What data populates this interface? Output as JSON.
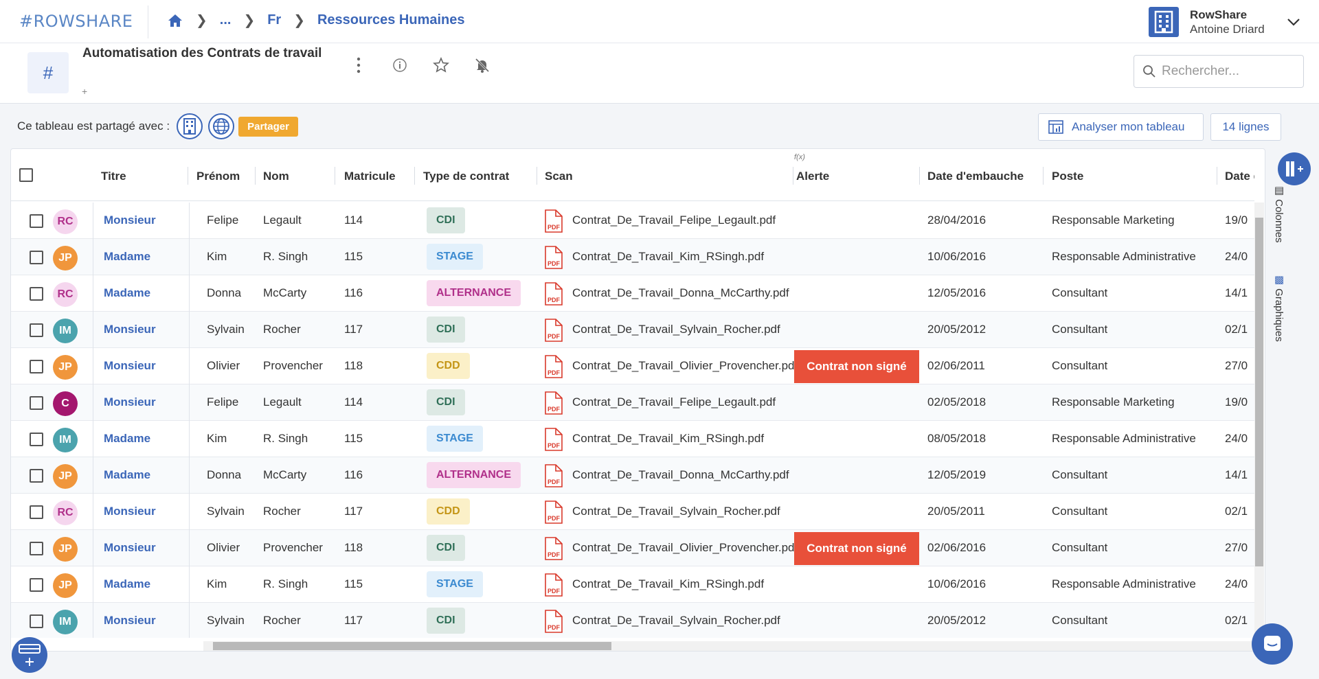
{
  "header": {
    "logo": "#ROWSHARE",
    "breadcrumb": [
      "...",
      "Fr",
      "Ressources Humaines"
    ],
    "account_org": "RowShare",
    "account_user": "Antoine Driard"
  },
  "sheet": {
    "title": "Automatisation des Contrats de travail",
    "add_label": "+",
    "search_placeholder": "Rechercher..."
  },
  "share": {
    "label": "Ce tableau est partagé avec :",
    "button": "Partager",
    "analyse": "Analyser mon tableau",
    "lines": "14 lignes"
  },
  "columns": [
    "Titre",
    "Prénom",
    "Nom",
    "Matricule",
    "Type de contrat",
    "Scan",
    "Alerte",
    "Date d'embauche",
    "Poste",
    "Date de"
  ],
  "fx_label": "f(x)",
  "side": {
    "colonnes": "Colonnes",
    "graphiques": "Graphiques"
  },
  "colors": {
    "accent": "#3b66b8",
    "alert": "#e8503a",
    "share_orange": "#f0a830",
    "tag_CDI": "#dde9e4",
    "tag_STAGE": "#e2f0fb",
    "tag_ALTERNANCE": "#f8d9ee",
    "tag_CDD": "#fbf0c8"
  },
  "rows": [
    {
      "avatar": "RC",
      "avatar_color": "pink",
      "titre": "Monsieur",
      "prenom": "Felipe",
      "nom": "Legault",
      "matricule": "114",
      "type": "CDI",
      "scan": "Contrat_De_Travail_Felipe_Legault.pdf",
      "alerte": "",
      "date": "28/04/2016",
      "poste": "Responsable Marketing",
      "date2": "19/0"
    },
    {
      "avatar": "JP",
      "avatar_color": "orange",
      "titre": "Madame",
      "prenom": "Kim",
      "nom": "R. Singh",
      "matricule": "115",
      "type": "STAGE",
      "scan": "Contrat_De_Travail_Kim_RSingh.pdf",
      "alerte": "",
      "date": "10/06/2016",
      "poste": "Responsable Administrative",
      "date2": "24/0"
    },
    {
      "avatar": "RC",
      "avatar_color": "pink",
      "titre": "Madame",
      "prenom": "Donna",
      "nom": "McCarty",
      "matricule": "116",
      "type": "ALTERNANCE",
      "scan": "Contrat_De_Travail_Donna_McCarthy.pdf",
      "alerte": "",
      "date": "12/05/2016",
      "poste": "Consultant",
      "date2": "14/1"
    },
    {
      "avatar": "IM",
      "avatar_color": "teal",
      "titre": "Monsieur",
      "prenom": "Sylvain",
      "nom": "Rocher",
      "matricule": "117",
      "type": "CDI",
      "scan": "Contrat_De_Travail_Sylvain_Rocher.pdf",
      "alerte": "",
      "date": "20/05/2012",
      "poste": "Consultant",
      "date2": "02/1"
    },
    {
      "avatar": "JP",
      "avatar_color": "orange",
      "titre": "Monsieur",
      "prenom": "Olivier",
      "nom": "Provencher",
      "matricule": "118",
      "type": "CDD",
      "scan": "Contrat_De_Travail_Olivier_Provencher.pdf",
      "alerte": "Contrat non signé",
      "date": "02/06/2011",
      "poste": "Consultant",
      "date2": "27/0"
    },
    {
      "avatar": "C",
      "avatar_color": "purple",
      "titre": "Monsieur",
      "prenom": "Felipe",
      "nom": "Legault",
      "matricule": "114",
      "type": "CDI",
      "scan": "Contrat_De_Travail_Felipe_Legault.pdf",
      "alerte": "",
      "date": "02/05/2018",
      "poste": "Responsable Marketing",
      "date2": "19/0"
    },
    {
      "avatar": "IM",
      "avatar_color": "teal",
      "titre": "Madame",
      "prenom": "Kim",
      "nom": "R. Singh",
      "matricule": "115",
      "type": "STAGE",
      "scan": "Contrat_De_Travail_Kim_RSingh.pdf",
      "alerte": "",
      "date": "08/05/2018",
      "poste": "Responsable Administrative",
      "date2": "24/0"
    },
    {
      "avatar": "JP",
      "avatar_color": "orange",
      "titre": "Madame",
      "prenom": "Donna",
      "nom": "McCarty",
      "matricule": "116",
      "type": "ALTERNANCE",
      "scan": "Contrat_De_Travail_Donna_McCarthy.pdf",
      "alerte": "",
      "date": "12/05/2019",
      "poste": "Consultant",
      "date2": "14/1"
    },
    {
      "avatar": "RC",
      "avatar_color": "pink",
      "titre": "Monsieur",
      "prenom": "Sylvain",
      "nom": "Rocher",
      "matricule": "117",
      "type": "CDD",
      "scan": "Contrat_De_Travail_Sylvain_Rocher.pdf",
      "alerte": "",
      "date": "20/05/2011",
      "poste": "Consultant",
      "date2": "02/1"
    },
    {
      "avatar": "JP",
      "avatar_color": "orange",
      "titre": "Monsieur",
      "prenom": "Olivier",
      "nom": "Provencher",
      "matricule": "118",
      "type": "CDI",
      "scan": "Contrat_De_Travail_Olivier_Provencher.pdf",
      "alerte": "Contrat non signé",
      "date": "02/06/2016",
      "poste": "Consultant",
      "date2": "27/0"
    },
    {
      "avatar": "JP",
      "avatar_color": "orange",
      "titre": "Madame",
      "prenom": "Kim",
      "nom": "R. Singh",
      "matricule": "115",
      "type": "STAGE",
      "scan": "Contrat_De_Travail_Kim_RSingh.pdf",
      "alerte": "",
      "date": "10/06/2016",
      "poste": "Responsable Administrative",
      "date2": "24/0"
    },
    {
      "avatar": "IM",
      "avatar_color": "teal",
      "titre": "Monsieur",
      "prenom": "Sylvain",
      "nom": "Rocher",
      "matricule": "117",
      "type": "CDI",
      "scan": "Contrat_De_Travail_Sylvain_Rocher.pdf",
      "alerte": "",
      "date": "20/05/2012",
      "poste": "Consultant",
      "date2": "02/1"
    }
  ]
}
